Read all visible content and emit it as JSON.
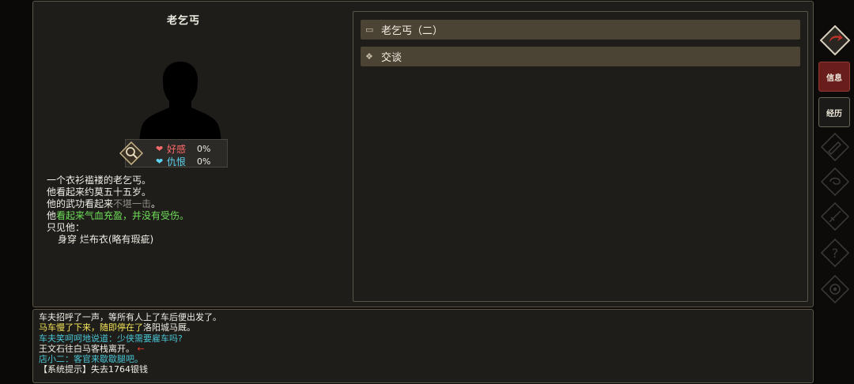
{
  "character": {
    "name": "老乞丐",
    "relations": {
      "favor_label": "好感",
      "favor_value": "0%",
      "hatred_label": "仇恨",
      "hatred_value": "0%"
    },
    "description": {
      "line1": "一个衣衫褴褛的老乞丐。",
      "line2": "他看起来约莫五十五岁。",
      "line3_prefix": "他的武功看起来",
      "line3_gray": "不堪一击",
      "line3_suffix": "。",
      "line4_prefix": "他",
      "line4_green": "看起来气血充盈，并没有受伤。",
      "line5": "只见他：",
      "line6": "身穿 烂布衣(略有瑕疵)"
    }
  },
  "actions": [
    {
      "icon": "scroll-icon",
      "label": "老乞丐（二）"
    },
    {
      "icon": "diamond-dots-icon",
      "label": "交谈"
    }
  ],
  "log": [
    {
      "parts": [
        {
          "text": "车夫招呼了一声，等所有人上了车后便出发了。",
          "color": "white"
        }
      ]
    },
    {
      "parts": [
        {
          "text": "马车慢了下来，随即停在了",
          "color": "yellow"
        },
        {
          "text": "洛阳城马厩。",
          "color": "white"
        }
      ]
    },
    {
      "parts": [
        {
          "text": "车夫笑呵呵地说道：少侠需要雇车吗?",
          "color": "cyan"
        }
      ]
    },
    {
      "parts": [
        {
          "text": "王文石往白马客栈离开。",
          "color": "white"
        },
        {
          "text": " ←",
          "color": "red"
        }
      ]
    },
    {
      "parts": [
        {
          "text": "店小二：客官来歇歇腿吧。",
          "color": "cyan"
        }
      ]
    },
    {
      "parts": [
        {
          "text": "【系统提示】失去1764银钱",
          "color": "white"
        }
      ]
    }
  ],
  "sidebar": {
    "tab_info": "信息",
    "tab_experience": "经历"
  },
  "colors": {
    "accent_red": "#6a1e1c",
    "button_bg": "#4b4333",
    "panel_bg": "#1f1d1a"
  }
}
